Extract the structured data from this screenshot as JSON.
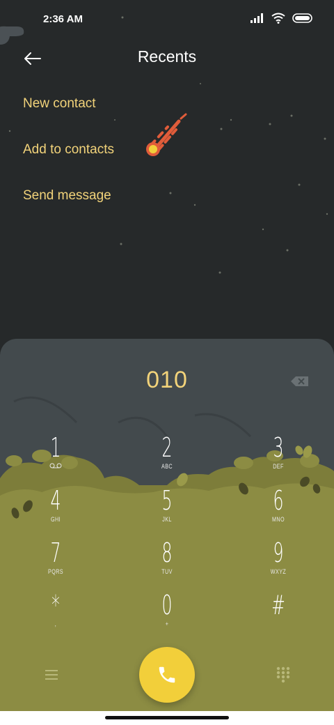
{
  "status_bar": {
    "time": "2:36 AM",
    "icons": [
      "signal-icon",
      "wifi-icon",
      "battery-icon"
    ]
  },
  "header": {
    "title": "Recents",
    "back_icon": "arrow-left-icon"
  },
  "menu": {
    "items": [
      {
        "label": "New contact"
      },
      {
        "label": "Add to contacts"
      },
      {
        "label": "Send message"
      }
    ]
  },
  "dialer": {
    "number": "010",
    "backspace_icon": "backspace-icon",
    "keys": [
      {
        "digit": "1",
        "letters": ""
      },
      {
        "digit": "2",
        "letters": "ABC"
      },
      {
        "digit": "3",
        "letters": "DEF"
      },
      {
        "digit": "4",
        "letters": "GHI"
      },
      {
        "digit": "5",
        "letters": "JKL"
      },
      {
        "digit": "6",
        "letters": "MNO"
      },
      {
        "digit": "7",
        "letters": "PQRS"
      },
      {
        "digit": "8",
        "letters": "TUV"
      },
      {
        "digit": "9",
        "letters": "WXYZ"
      },
      {
        "digit": "*",
        "letters": ","
      },
      {
        "digit": "0",
        "letters": "+"
      },
      {
        "digit": "#",
        "letters": ""
      }
    ],
    "bottom": {
      "menu_icon": "hamburger-menu-icon",
      "call_icon": "phone-icon",
      "keypad_icon": "dialpad-icon"
    }
  },
  "colors": {
    "background": "#26292a",
    "accent_text": "#f2d37a",
    "panel": "#434a4d",
    "foliage": "#8c8c43",
    "call_button": "#f2cf3a"
  }
}
